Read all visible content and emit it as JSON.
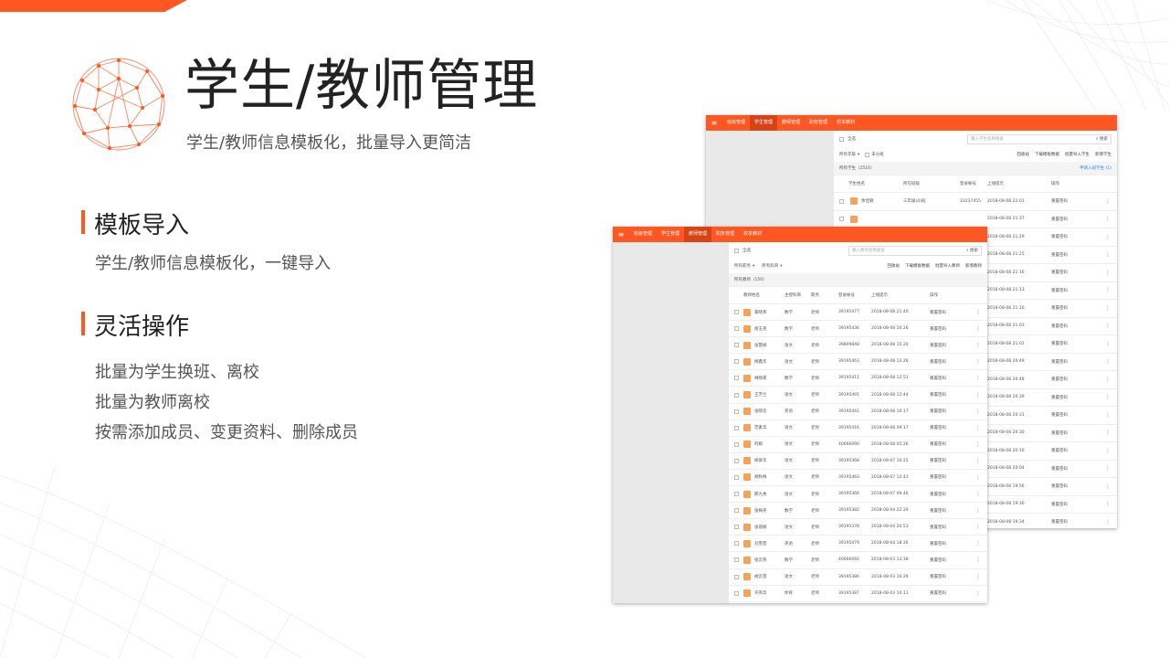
{
  "title": "学生/教师管理",
  "subtitle": "学生/教师信息模板化，批量导入更简洁",
  "section1": {
    "title": "模板导入",
    "text": "学生/教师信息模板化，一键导入"
  },
  "section2": {
    "title": "灵活操作",
    "lines": [
      "批量为学生换班、离校",
      "批量为教师离校",
      "按需添加成员、变更资料、删除成员"
    ]
  },
  "colors": {
    "accent": "#ff5722",
    "accent_dark": "#d84315"
  },
  "nav_tabs": [
    "班级管理",
    "学生管理",
    "教师管理",
    "职务管理",
    "校本教材"
  ],
  "student_window": {
    "select_all": "全选",
    "search_placeholder": "输入学生名称搜索",
    "search_button": "搜索",
    "filter_grade": "所有年级",
    "unassigned": "未分班",
    "actions": [
      "回收站",
      "下载模板数据",
      "批量导入学生",
      "新增学生"
    ],
    "count_label": "所有学生（2516）",
    "apply_link": "申请入班学生 (1)",
    "headers": [
      "学生姓名",
      "所在班级",
      "登录帐号",
      "上线提示",
      "操作"
    ],
    "rows": [
      {
        "name": "余佳颖",
        "cls": "三年级(4)班",
        "acct": "33237455",
        "time": "2018-08-08 22:01",
        "op": "重置密码"
      },
      {
        "name": "",
        "cls": "",
        "acct": "",
        "time": "2018-08-08 21:37",
        "op": "重置密码"
      },
      {
        "name": "",
        "cls": "",
        "acct": "",
        "time": "2018-08-08 21:29",
        "op": "重置密码"
      },
      {
        "name": "",
        "cls": "",
        "acct": "",
        "time": "2018-08-08 21:25",
        "op": "重置密码"
      },
      {
        "name": "",
        "cls": "",
        "acct": "",
        "time": "2018-08-08 21:16",
        "op": "重置密码"
      },
      {
        "name": "",
        "cls": "",
        "acct": "",
        "time": "2018-08-08 21:13",
        "op": "重置密码"
      },
      {
        "name": "",
        "cls": "",
        "acct": "",
        "time": "2018-08-08 21:10",
        "op": "重置密码"
      },
      {
        "name": "",
        "cls": "",
        "acct": "",
        "time": "2018-08-08 21:03",
        "op": "重置密码"
      },
      {
        "name": "",
        "cls": "",
        "acct": "",
        "time": "2018-08-08 21:02",
        "op": "重置密码"
      },
      {
        "name": "",
        "cls": "",
        "acct": "",
        "time": "2018-08-08 20:49",
        "op": "重置密码"
      },
      {
        "name": "",
        "cls": "",
        "acct": "",
        "time": "2018-08-08 20:48",
        "op": "重置密码"
      },
      {
        "name": "",
        "cls": "",
        "acct": "",
        "time": "2018-08-08 20:39",
        "op": "重置密码"
      },
      {
        "name": "",
        "cls": "",
        "acct": "",
        "time": "2018-08-08 20:31",
        "op": "重置密码"
      },
      {
        "name": "",
        "cls": "",
        "acct": "",
        "time": "2018-08-08 20:30",
        "op": "重置密码"
      },
      {
        "name": "",
        "cls": "",
        "acct": "",
        "time": "2018-08-08 20:16",
        "op": "重置密码"
      },
      {
        "name": "",
        "cls": "",
        "acct": "",
        "time": "2018-08-08 20:04",
        "op": "重置密码"
      },
      {
        "name": "",
        "cls": "",
        "acct": "",
        "time": "2018-08-08 19:56",
        "op": "重置密码"
      },
      {
        "name": "",
        "cls": "",
        "acct": "",
        "time": "2018-08-08 19:36",
        "op": "重置密码"
      },
      {
        "name": "",
        "cls": "",
        "acct": "",
        "time": "2018-08-08 19:34",
        "op": "重置密码"
      }
    ]
  },
  "teacher_window": {
    "select_all": "全选",
    "search_placeholder": "输入教师名称搜索",
    "search_button": "搜索",
    "filter_role": "所有职务",
    "filter_subject": "所有科目",
    "actions": [
      "回收站",
      "下载模板数据",
      "批量导入教师",
      "新增教师"
    ],
    "count_label": "所有教师（150）",
    "headers": [
      "教师姓名",
      "主授科目",
      "职务",
      "登录帐号",
      "上线提示",
      "操作"
    ],
    "rows": [
      {
        "name": "黄晓燕",
        "subj": "数学",
        "role": "老师",
        "acct": "39195477",
        "time": "2018-08-08 21:40",
        "op": "重置密码"
      },
      {
        "name": "谢玉英",
        "subj": "数学",
        "role": "老师",
        "acct": "39195436",
        "time": "2018-08-08 16:26",
        "op": "重置密码"
      },
      {
        "name": "张慧娟",
        "subj": "语文",
        "role": "老师",
        "acct": "39809848",
        "time": "2018-08-08 15:20",
        "op": "重置密码"
      },
      {
        "name": "杨鑫华",
        "subj": "语文",
        "role": "老师",
        "acct": "39195463",
        "time": "2018-08-08 13:26",
        "op": "重置密码"
      },
      {
        "name": "林晓筱",
        "subj": "数学",
        "role": "老师",
        "acct": "39195411",
        "time": "2018-08-08 12:51",
        "op": "重置密码"
      },
      {
        "name": "王芳兰",
        "subj": "语文",
        "role": "老师",
        "acct": "39195491",
        "time": "2018-08-08 12:44",
        "op": "重置密码"
      },
      {
        "name": "张晓云",
        "subj": "英语",
        "role": "老师",
        "acct": "39195441",
        "time": "2018-08-08 10:17",
        "op": "重置密码"
      },
      {
        "name": "范素华",
        "subj": "语文",
        "role": "老师",
        "acct": "39195416",
        "time": "2018-08-08 09:17",
        "op": "重置密码"
      },
      {
        "name": "何娟",
        "subj": "语文",
        "role": "老师",
        "acct": "40666090",
        "time": "2018-08-08 05:26",
        "op": "重置密码"
      },
      {
        "name": "胡翠华",
        "subj": "语文",
        "role": "老师",
        "acct": "39195368",
        "time": "2018-08-07 16:25",
        "op": "重置密码"
      },
      {
        "name": "胡秋梅",
        "subj": "语文",
        "role": "老师",
        "acct": "39195463",
        "time": "2018-08-07 12:41",
        "op": "重置密码"
      },
      {
        "name": "邢九秀",
        "subj": "语文",
        "role": "老师",
        "acct": "39195366",
        "time": "2018-08-07 09:46",
        "op": "重置密码"
      },
      {
        "name": "张梅英",
        "subj": "数学",
        "role": "老师",
        "acct": "39195382",
        "time": "2018-08-04 22:29",
        "op": "重置密码"
      },
      {
        "name": "张丽娟",
        "subj": "语文",
        "role": "老师",
        "acct": "39195378",
        "time": "2018-08-04 20:53",
        "op": "重置密码"
      },
      {
        "name": "刘雪芸",
        "subj": "英语",
        "role": "老师",
        "acct": "39195479",
        "time": "2018-08-04 18:26",
        "op": "重置密码"
      },
      {
        "name": "张云燕",
        "subj": "数学",
        "role": "老师",
        "acct": "40666092",
        "time": "2018-08-03 13:38",
        "op": "重置密码"
      },
      {
        "name": "胡云芸",
        "subj": "语文",
        "role": "老师",
        "acct": "39195386",
        "time": "2018-08-03 16:29",
        "op": "重置密码"
      },
      {
        "name": "许英华",
        "subj": "体育",
        "role": "老师",
        "acct": "39195387",
        "time": "2018-08-03 10:11",
        "op": "重置密码"
      },
      {
        "name": "郑红霞",
        "subj": "语文",
        "role": "老师",
        "acct": "39195481",
        "time": "2018-08-03 10:02",
        "op": "重置密码"
      }
    ]
  }
}
